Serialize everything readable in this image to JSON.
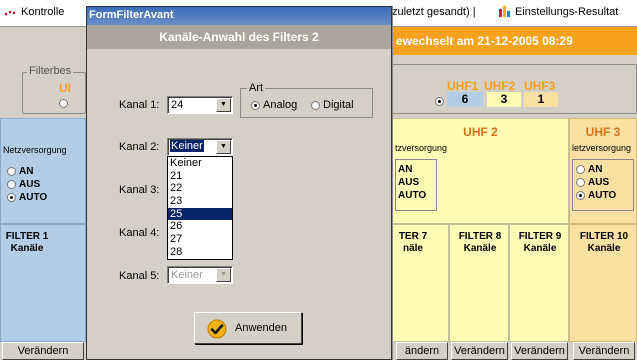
{
  "topbar": {
    "tab1_label": "Kontrolle",
    "tab2_label": "zuletzt gesandt)",
    "tab3_label": "Einstellungs-Resultat"
  },
  "status_strip": {
    "text": "ewechselt am 21-12-2005 08:29"
  },
  "filterbes_legend": "Filterbes",
  "filterbes_prefix": "UI",
  "uhf": {
    "labels": [
      "UHF1",
      "UHF2",
      "UHF3"
    ],
    "values": [
      "6",
      "3",
      "1"
    ]
  },
  "columns": {
    "left_netz": "Netzversorgung",
    "left_filter_title": "FILTER 1",
    "left_filter_sub": "Kanäle",
    "uhf2_title": "UHF 2",
    "uhf2_netz": "tzversorgung",
    "uhf3_title": "UHF 3",
    "uhf3_netz": "letzversorgung",
    "radio_an": "AN",
    "radio_aus": "AUS",
    "radio_auto": "AUTO"
  },
  "filters": [
    {
      "title": "TER 7",
      "sub": "näle"
    },
    {
      "title": "FILTER 8",
      "sub": "Kanäle"
    },
    {
      "title": "FILTER 9",
      "sub": "Kanäle"
    },
    {
      "title": "FILTER 10",
      "sub": "Kanäle"
    }
  ],
  "change_label": "Verändern",
  "change_label_partial": "ändern",
  "dialog": {
    "window_title": "FormFilterAvant",
    "header": "Kanäle-Anwahl des Filters 2",
    "kanal1_label": "Kanal 1:",
    "kanal1_value": "24",
    "kanal2_label": "Kanal 2:",
    "kanal2_value": "Keiner",
    "kanal3_label": "Kanal 3:",
    "kanal4_label": "Kanal 4:",
    "kanal5_label": "Kanal 5:",
    "kanal5_value": "Keiner",
    "art_legend": "Art",
    "art_analog": "Analog",
    "art_digital": "Digital",
    "dropdown_options": [
      "Keiner",
      "21",
      "22",
      "23",
      "25",
      "26",
      "27",
      "28"
    ],
    "dropdown_selected": "25",
    "apply_label": "Anwenden"
  },
  "colors": {
    "accent_orange": "#f7a21c",
    "uhf_yellow": "#fefcb5",
    "selection_blue": "#0a246a"
  }
}
